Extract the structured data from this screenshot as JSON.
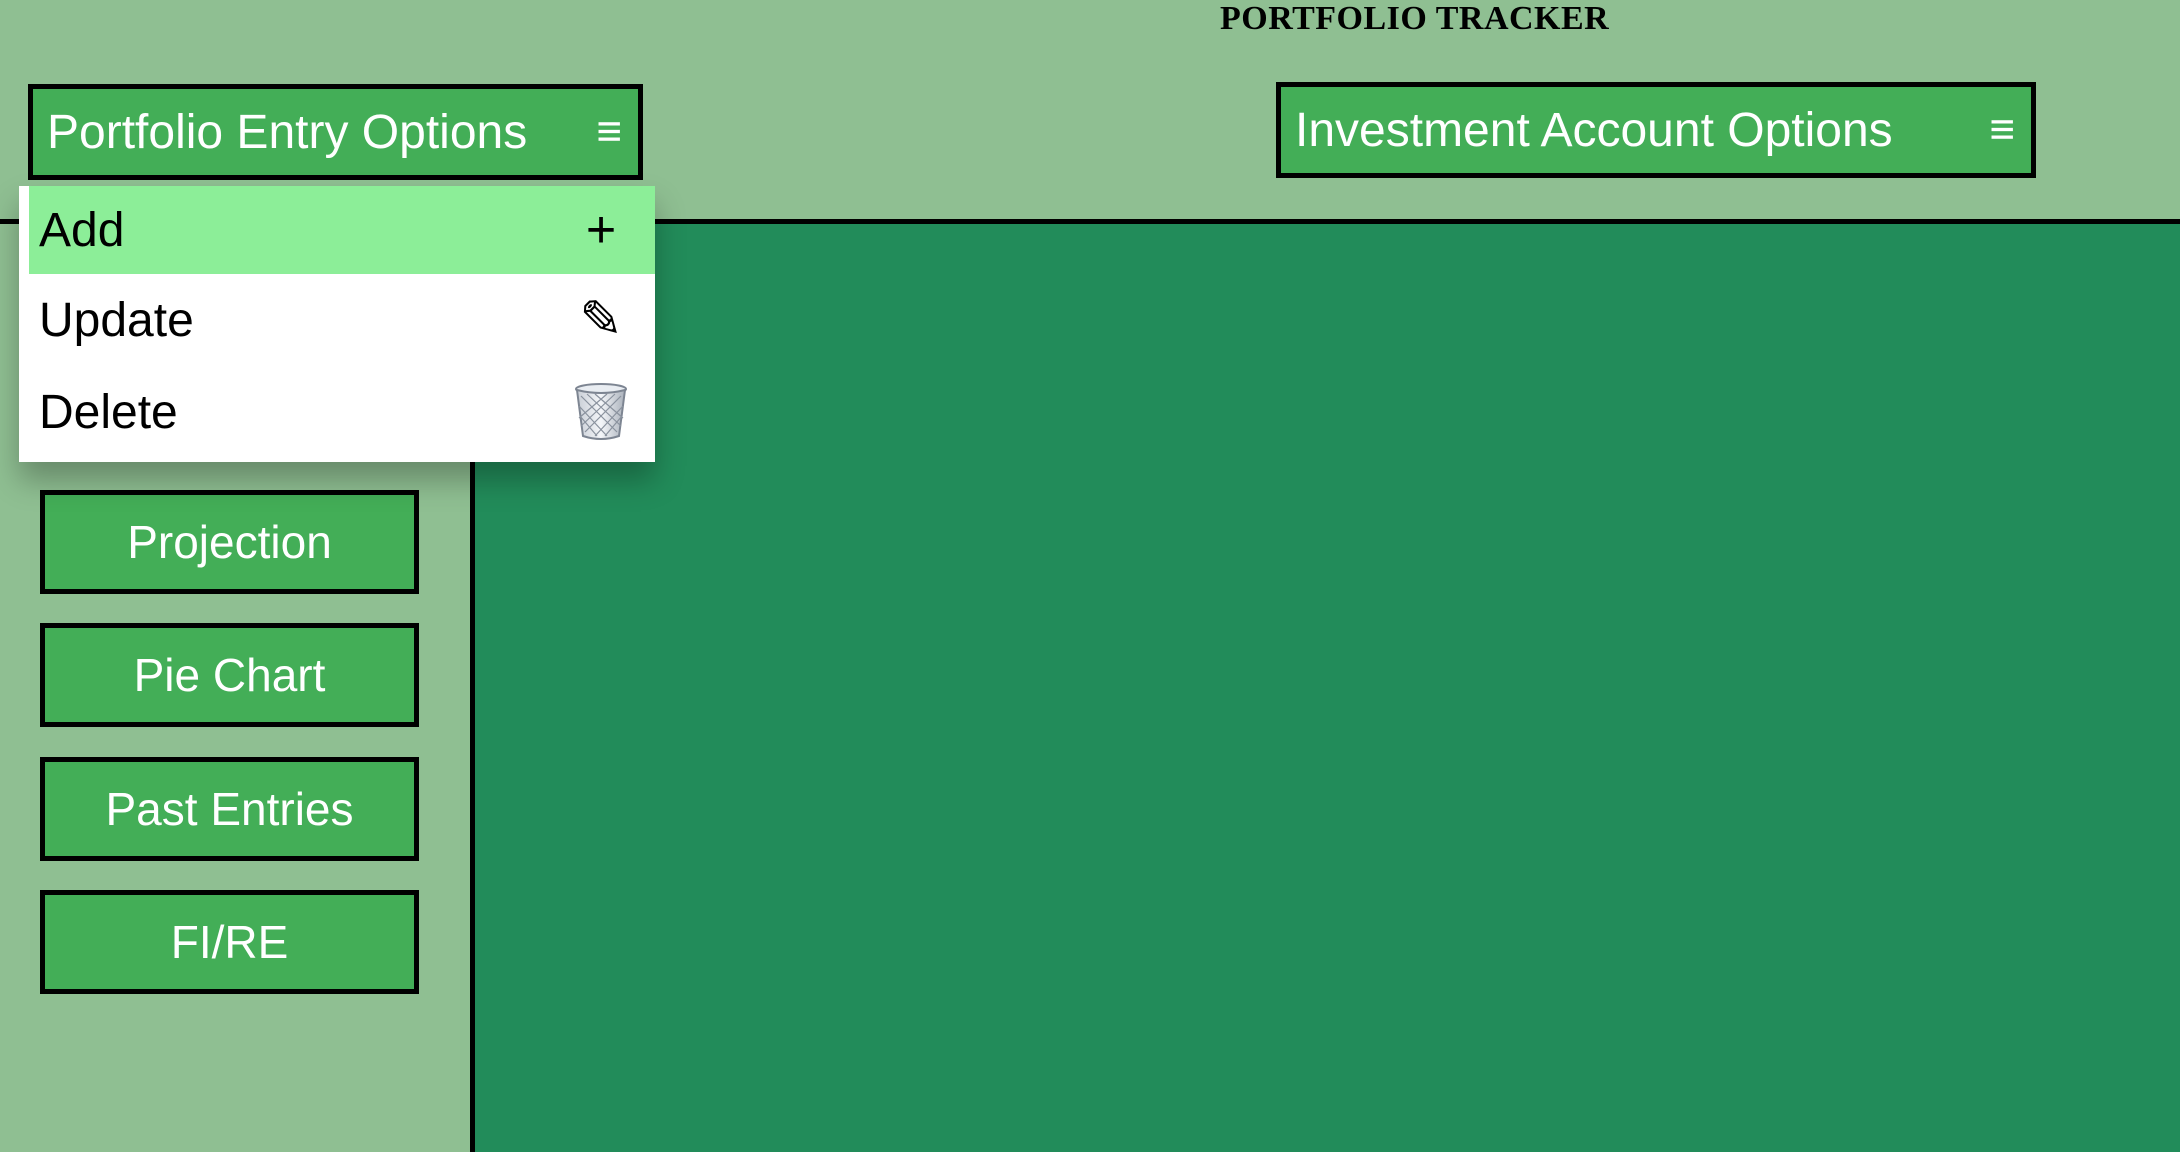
{
  "header": {
    "title": "PORTFOLIO TRACKER"
  },
  "menus": {
    "entry_options": {
      "label": "Portfolio Entry Options",
      "icon": "hamburger-menu-icon",
      "glyph": "≡"
    },
    "account_options": {
      "label": "Investment Account Options",
      "icon": "hamburger-menu-icon",
      "glyph": "≡"
    }
  },
  "dropdown": {
    "items": [
      {
        "label": "Add",
        "icon": "plus-icon",
        "glyph": "+",
        "highlighted": true
      },
      {
        "label": "Update",
        "icon": "pencil-icon",
        "glyph": "✎",
        "highlighted": false
      },
      {
        "label": "Delete",
        "icon": "trash-can-icon",
        "glyph": "",
        "highlighted": false
      }
    ]
  },
  "sidebar": {
    "buttons": [
      {
        "label": "Projection"
      },
      {
        "label": "Pie Chart"
      },
      {
        "label": "Past Entries"
      },
      {
        "label": "FI/RE"
      }
    ]
  },
  "colors": {
    "background": "#8fbf92",
    "button_green": "#43ae57",
    "content_panel": "#228c5a",
    "highlight": "#8cee98",
    "border": "#000000"
  }
}
